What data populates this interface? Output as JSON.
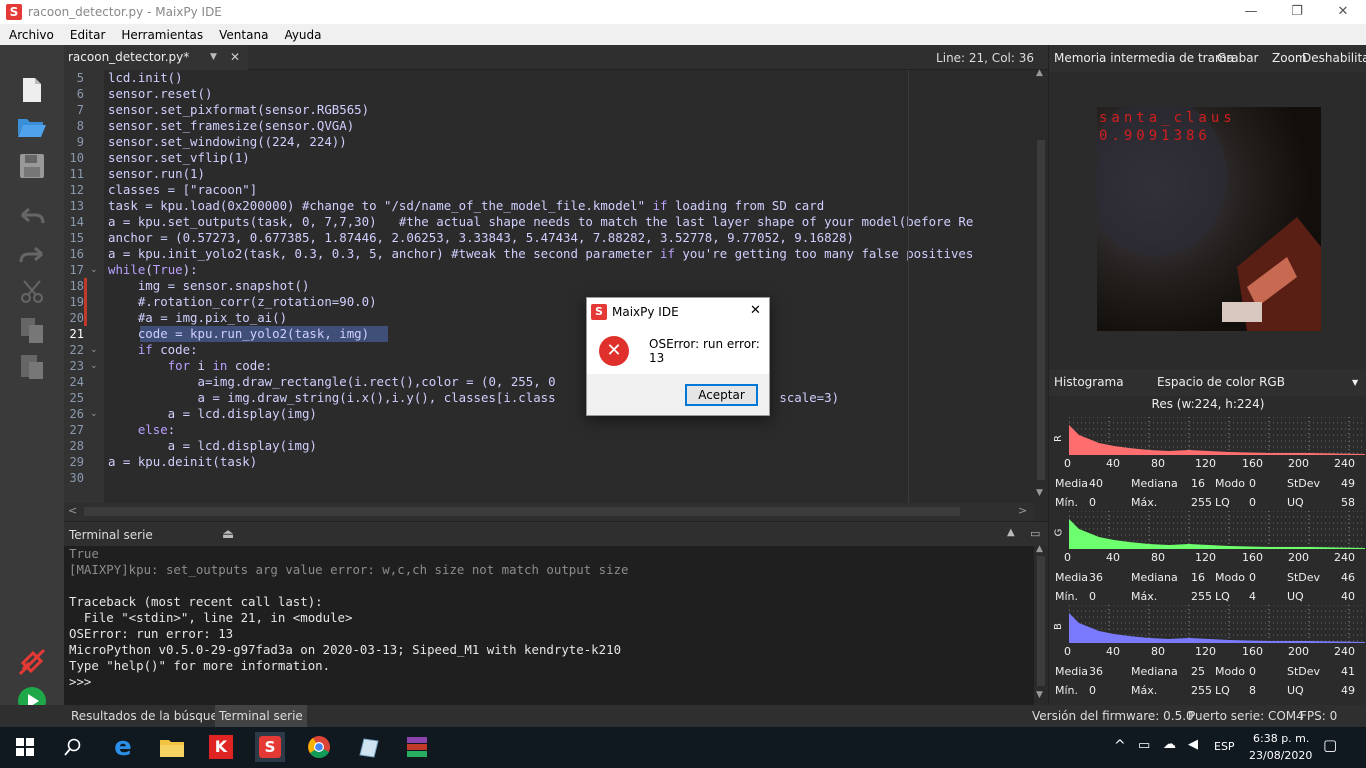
{
  "window": {
    "title": "racoon_detector.py - MaixPy IDE",
    "minimize": "—",
    "maximize": "❐",
    "close": "✕"
  },
  "menu": [
    "Archivo",
    "Editar",
    "Herramientas",
    "Ventana",
    "Ayuda"
  ],
  "editor": {
    "tab_label": "racoon_detector.py*",
    "close_tab": "✕",
    "cursor_position": "Line: 21, Col: 36",
    "line_numbers": [
      "5",
      "6",
      "7",
      "8",
      "9",
      "10",
      "11",
      "12",
      "13",
      "14",
      "15",
      "16",
      "17",
      "18",
      "19",
      "20",
      "21",
      "22",
      "23",
      "24",
      "25",
      "26",
      "27",
      "28",
      "29",
      "30"
    ],
    "lines": [
      "lcd.init()",
      "sensor.reset()",
      "sensor.set_pixformat(sensor.RGB565)",
      "sensor.set_framesize(sensor.QVGA)",
      "sensor.set_windowing((224, 224))",
      "sensor.set_vflip(1)",
      "sensor.run(1)",
      "classes = [\"racoon\"]",
      "task = kpu.load(0x200000) #change to \"/sd/name_of_the_model_file.kmodel\" if loading from SD card",
      "a = kpu.set_outputs(task, 0, 7,7,30)   #the actual shape needs to match the last layer shape of your model(before Re",
      "anchor = (0.57273, 0.677385, 1.87446, 2.06253, 3.33843, 5.47434, 7.88282, 3.52778, 9.77052, 9.16828)",
      "a = kpu.init_yolo2(task, 0.3, 0.3, 5, anchor) #tweak the second parameter if you're getting too many false positives",
      "while(True):",
      "    img = sensor.snapshot()",
      "    #.rotation_corr(z_rotation=90.0)",
      "    #a = img.pix_to_ai()",
      "    code = kpu.run_yolo2(task, img)",
      "    if code:",
      "        for i in code:",
      "            a=img.draw_rectangle(i.rect(),color = (0, 255, 0",
      "            a = img.draw_string(i.x(),i.y(), classes[i.class                              scale=3)",
      "        a = lcd.display(img)",
      "    else:",
      "        a = lcd.display(img)",
      "a = kpu.deinit(task)",
      ""
    ]
  },
  "terminal": {
    "title": "Terminal serie",
    "lines": [
      "True",
      "[MAIXPY]kpu: set_outputs arg value error: w,c,ch size not match output size",
      "",
      "Traceback (most recent call last):",
      "  File \"<stdin>\", line 21, in <module>",
      "OSError: run error: 13",
      "MicroPython v0.5.0-29-g97fad3a on 2020-03-13; Sipeed_M1 with kendryte-k210",
      "Type \"help()\" for more information.",
      ">>>"
    ]
  },
  "bottom": {
    "tab_search": "Resultados de la búsqueda",
    "tab_terminal": "Terminal serie",
    "firmware": "Versión del firmware: 0.5.0",
    "port": "Puerto serie: COM4",
    "fps": "FPS: 0"
  },
  "framebuffer": {
    "title": "Memoria intermedia de trama",
    "record": "Grabar",
    "zoom": "Zoom",
    "disable": "Deshabilitar",
    "overlay_line1": "santa_claus",
    "overlay_line2": "0.9091386"
  },
  "histogram": {
    "title": "Histograma",
    "colorspace": "Espacio de color RGB",
    "resolution": "Res (w:224, h:224)",
    "ticks": [
      "0",
      "40",
      "80",
      "120",
      "160",
      "200",
      "240"
    ],
    "channels": [
      {
        "name": "R",
        "color": "#ff6e6e",
        "media": "40",
        "mediana": "16",
        "modo": "0",
        "stdev": "49",
        "min": "0",
        "max": "255",
        "lq": "0",
        "uq": "58"
      },
      {
        "name": "G",
        "color": "#6eff6e",
        "media": "36",
        "mediana": "16",
        "modo": "0",
        "stdev": "46",
        "min": "0",
        "max": "255",
        "lq": "4",
        "uq": "40"
      },
      {
        "name": "B",
        "color": "#7a7aff",
        "media": "36",
        "mediana": "25",
        "modo": "0",
        "stdev": "41",
        "min": "0",
        "max": "255",
        "lq": "8",
        "uq": "49"
      }
    ],
    "labels": {
      "media": "Media",
      "mediana": "Mediana",
      "modo": "Modo",
      "stdev": "StDev",
      "min": "Mín.",
      "max": "Máx.",
      "lq": "LQ",
      "uq": "UQ"
    }
  },
  "dialog": {
    "title": "MaixPy IDE",
    "message": "OSError: run error: 13",
    "button": "Aceptar",
    "close": "✕"
  },
  "taskbar": {
    "lang": "ESP",
    "time": "6:38 p. m.",
    "date": "23/08/2020"
  }
}
